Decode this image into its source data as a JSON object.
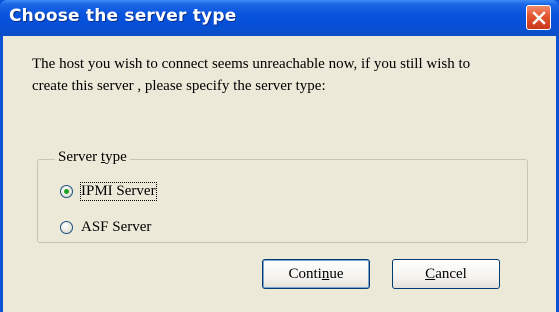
{
  "window": {
    "title": "Choose the server type"
  },
  "message": "The host you wish to connect seems unreachable now, if you still wish to create this server , please specify the server type:",
  "group": {
    "label": "Server type",
    "options": [
      {
        "label": "IPMI Server",
        "selected": true
      },
      {
        "label": "ASF Server",
        "selected": false
      }
    ]
  },
  "buttons": {
    "continue": "Continue",
    "cancel": "Cancel"
  },
  "colors": {
    "titlebar": "#0650d8",
    "client_bg": "#ece9d8",
    "close_button": "#e2542e"
  },
  "icons": {
    "close": "close-icon"
  }
}
